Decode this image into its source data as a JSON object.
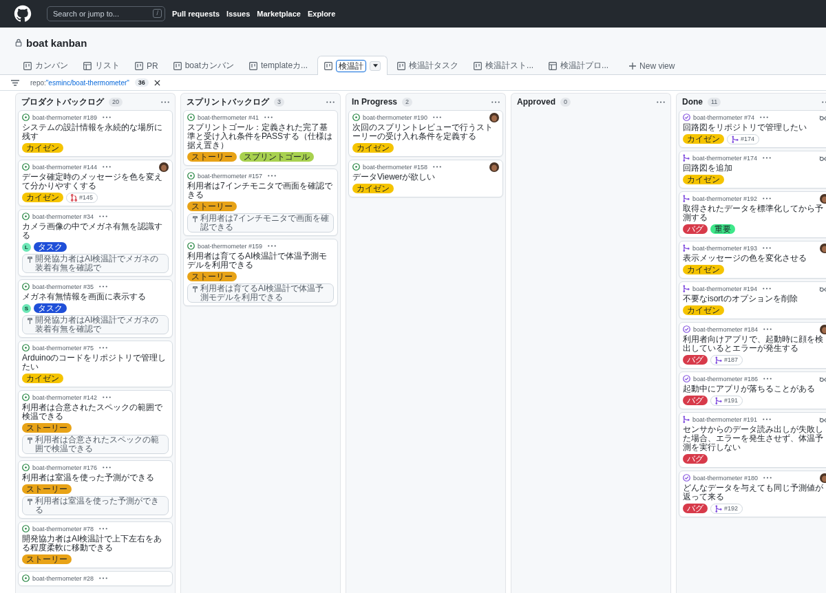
{
  "nav": {
    "search_placeholder": "Search or jump to...",
    "search_key": "/",
    "links": [
      "Pull requests",
      "Issues",
      "Marketplace",
      "Explore"
    ]
  },
  "project": {
    "title": "boat kanban",
    "private": true
  },
  "tabs": [
    {
      "label": "カンバン",
      "kind": "board",
      "selected": false
    },
    {
      "label": "リスト",
      "kind": "table",
      "selected": false
    },
    {
      "label": "PR",
      "kind": "board",
      "selected": false
    },
    {
      "label": "boatカンバン",
      "kind": "board",
      "selected": false
    },
    {
      "label": "templateカ...",
      "kind": "board",
      "selected": false
    },
    {
      "label": "検温計",
      "kind": "board",
      "selected": true
    },
    {
      "label": "検温計タスク",
      "kind": "board",
      "selected": false
    },
    {
      "label": "検温計スト...",
      "kind": "board",
      "selected": false
    },
    {
      "label": "検温計プロ...",
      "kind": "table",
      "selected": false
    }
  ],
  "new_view": "New view",
  "filter": {
    "key": "repo:",
    "value": "\"esminc/boat-thermometer\"",
    "count": "36"
  },
  "columns": [
    {
      "name": "プロダクトバックログ",
      "count": "20",
      "cards": [
        {
          "kind": "open",
          "ref": "boat-thermometer #189",
          "title": "システムの設計情報を永続的な場所に残す",
          "labels": [
            {
              "text": "カイゼン",
              "color": "#f5c400"
            }
          ]
        },
        {
          "kind": "open",
          "ref": "boat-thermometer #144",
          "assignee": {
            "kind": "photo"
          },
          "title": "データ確定時のメッセージを色を変えて分かりやすくする",
          "labels": [
            {
              "text": "カイゼン",
              "color": "#f5c400"
            }
          ],
          "links": [
            {
              "kind": "closed-pr",
              "text": "#145"
            }
          ]
        },
        {
          "kind": "open",
          "ref": "boat-thermometer #34",
          "title": "カメラ画像の中でメガネ有無を認識する",
          "initial": "L",
          "labels": [
            {
              "text": "タスク",
              "color": "#1f4fd8"
            }
          ],
          "links": [
            {
              "kind": "tracked",
              "text": "開発協力者はAI検温計でメガネの装着有無を確認で"
            }
          ]
        },
        {
          "kind": "open",
          "ref": "boat-thermometer #35",
          "title": "メガネ有無情報を画面に表示する",
          "initial": "S",
          "labels": [
            {
              "text": "タスク",
              "color": "#1f4fd8"
            }
          ],
          "links": [
            {
              "kind": "tracked",
              "text": "開発協力者はAI検温計でメガネの装着有無を確認で"
            }
          ]
        },
        {
          "kind": "open",
          "ref": "boat-thermometer #75",
          "title": "Arduinoのコードをリポジトリで管理したい",
          "labels": [
            {
              "text": "カイゼン",
              "color": "#f5c400"
            }
          ]
        },
        {
          "kind": "open",
          "ref": "boat-thermometer #142",
          "title": "利用者は合意されたスペックの範囲で検温できる",
          "labels": [
            {
              "text": "ストーリー",
              "color": "#e8a317"
            }
          ],
          "links": [
            {
              "kind": "tracked",
              "text": "利用者は合意されたスペックの範囲で検温できる"
            }
          ]
        },
        {
          "kind": "open",
          "ref": "boat-thermometer #176",
          "title": "利用者は室温を使った予測ができる",
          "labels": [
            {
              "text": "ストーリー",
              "color": "#e8a317"
            }
          ],
          "links": [
            {
              "kind": "tracked",
              "text": "利用者は室温を使った予測ができる"
            }
          ]
        },
        {
          "kind": "open",
          "ref": "boat-thermometer #78",
          "title": "開発協力者はAI検温計で上下左右をある程度柔軟に移動できる",
          "labels": [
            {
              "text": "ストーリー",
              "color": "#e8a317"
            }
          ]
        },
        {
          "kind": "open",
          "ref": "boat-thermometer #28"
        }
      ]
    },
    {
      "name": "スプリントバックログ",
      "count": "3",
      "cards": [
        {
          "kind": "open",
          "ref": "boat-thermometer #41",
          "title": "スプリントゴール：定義された完了基準と受け入れ条件をPASSする（仕様は据え置き）",
          "labels": [
            {
              "text": "ストーリー",
              "color": "#e8a317"
            },
            {
              "text": "スプリントゴール",
              "color": "#a8d14f"
            }
          ]
        },
        {
          "kind": "open",
          "ref": "boat-thermometer #157",
          "title": "利用者は7インチモニタで画面を確認できる",
          "labels": [
            {
              "text": "ストーリー",
              "color": "#e8a317"
            }
          ],
          "links": [
            {
              "kind": "tracked",
              "text": "利用者は7インチモニタで画面を確認できる"
            }
          ]
        },
        {
          "kind": "open",
          "ref": "boat-thermometer #159",
          "title": "利用者は育てるAI検温計で体温予測モデルを利用できる",
          "labels": [
            {
              "text": "ストーリー",
              "color": "#e8a317"
            }
          ],
          "links": [
            {
              "kind": "tracked",
              "text": "利用者は育てるAI検温計で体温予測モデルを利用できる"
            }
          ]
        }
      ]
    },
    {
      "name": "In Progress",
      "count": "2",
      "cards": [
        {
          "kind": "open",
          "ref": "boat-thermometer #190",
          "assignee": {
            "kind": "photo"
          },
          "title": "次回のスプリントレビューで行うストーリーの受け入れ条件を定義する",
          "labels": [
            {
              "text": "カイゼン",
              "color": "#f5c400"
            }
          ]
        },
        {
          "kind": "open",
          "ref": "boat-thermometer #158",
          "assignee": {
            "kind": "photo"
          },
          "title": "データViewerが欲しい",
          "labels": [
            {
              "text": "カイゼン",
              "color": "#f5c400"
            }
          ]
        }
      ]
    },
    {
      "name": "Approved",
      "count": "0"
    },
    {
      "name": "Done",
      "count": "11",
      "cards": [
        {
          "kind": "closed",
          "ref": "boat-thermometer #74",
          "assignee": {
            "kind": "glasses"
          },
          "title": "回路図をリポジトリで管理したい",
          "labels": [
            {
              "text": "カイゼン",
              "color": "#f5c400"
            }
          ],
          "links": [
            {
              "kind": "merged-pr",
              "text": "#174"
            }
          ]
        },
        {
          "kind": "merged",
          "ref": "boat-thermometer #174",
          "assignee": {
            "kind": "glasses"
          },
          "title": "回路図を追加",
          "labels": [
            {
              "text": "カイゼン",
              "color": "#f5c400"
            }
          ]
        },
        {
          "kind": "merged",
          "ref": "boat-thermometer #192",
          "assignee": {
            "kind": "photo"
          },
          "title": "取得されたデータを標準化してから予測する",
          "labels": [
            {
              "text": "バグ",
              "color": "#d73a4a"
            },
            {
              "text": "重要",
              "color": "#3ee88a"
            }
          ]
        },
        {
          "kind": "merged",
          "ref": "boat-thermometer #193",
          "assignee": {
            "kind": "photo"
          },
          "title": "表示メッセージの色を変化させる",
          "labels": [
            {
              "text": "カイゼン",
              "color": "#f5c400"
            }
          ]
        },
        {
          "kind": "merged",
          "ref": "boat-thermometer #194",
          "assignee": {
            "kind": "glasses"
          },
          "title": "不要なisortのオプションを削除",
          "labels": [
            {
              "text": "カイゼン",
              "color": "#f5c400"
            }
          ]
        },
        {
          "kind": "closed",
          "ref": "boat-thermometer #184",
          "assignee": {
            "kind": "photo"
          },
          "title": "利用者向けアプリで、起動時に顔を検出しているとエラーが発生する",
          "labels": [
            {
              "text": "バグ",
              "color": "#d73a4a"
            }
          ],
          "links": [
            {
              "kind": "merged-pr",
              "text": "#187"
            }
          ]
        },
        {
          "kind": "closed",
          "ref": "boat-thermometer #186",
          "assignee": {
            "kind": "glasses"
          },
          "title": "起動中にアプリが落ちることがある",
          "labels": [
            {
              "text": "バグ",
              "color": "#d73a4a"
            }
          ],
          "links": [
            {
              "kind": "merged-pr",
              "text": "#191"
            }
          ]
        },
        {
          "kind": "merged",
          "ref": "boat-thermometer #191",
          "assignee": {
            "kind": "glasses"
          },
          "title": "センサからのデータ読み出しが失敗した場合、エラーを発生させず、体温予測を実行しない",
          "labels": [
            {
              "text": "バグ",
              "color": "#d73a4a"
            }
          ]
        },
        {
          "kind": "closed",
          "ref": "boat-thermometer #180",
          "assignee": {
            "kind": "photo"
          },
          "title": "どんなデータを与えても同じ予測値が返って来る",
          "labels": [
            {
              "text": "バグ",
              "color": "#d73a4a"
            }
          ],
          "links": [
            {
              "kind": "merged-pr",
              "text": "#192"
            }
          ]
        }
      ]
    }
  ]
}
